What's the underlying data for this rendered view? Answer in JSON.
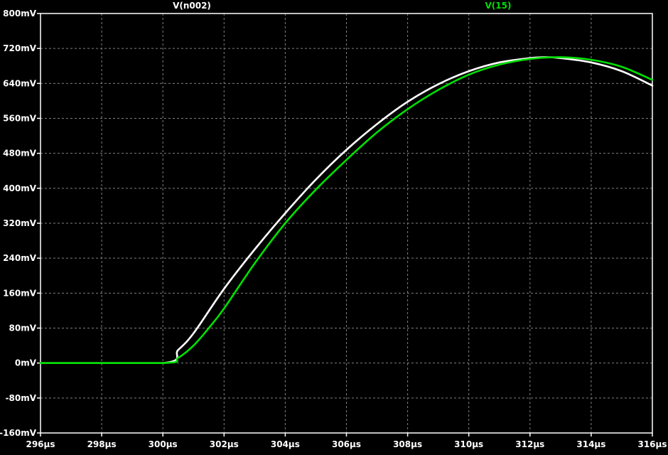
{
  "chart_data": {
    "type": "line",
    "title": "",
    "xlabel": "",
    "ylabel": "",
    "background": "#000000",
    "grid": true,
    "grid_color": "#808080",
    "axis_color": "#ffffff",
    "label_color": "#ffffff",
    "xlim": [
      296,
      316
    ],
    "ylim": [
      -160,
      800
    ],
    "x_ticks": [
      296,
      298,
      300,
      302,
      304,
      306,
      308,
      310,
      312,
      314,
      316
    ],
    "x_tick_labels": [
      "296µs",
      "298µs",
      "300µs",
      "302µs",
      "304µs",
      "306µs",
      "308µs",
      "310µs",
      "312µs",
      "314µs",
      "316µs"
    ],
    "y_ticks": [
      800,
      720,
      640,
      560,
      480,
      400,
      320,
      240,
      160,
      80,
      0,
      -80,
      -160
    ],
    "y_tick_labels": [
      "800mV",
      "720mV",
      "640mV",
      "560mV",
      "480mV",
      "400mV",
      "320mV",
      "240mV",
      "160mV",
      "80mV",
      "0mV",
      "-80mV",
      "-160mV"
    ],
    "series": [
      {
        "name": "V(n002)",
        "color": "#ffffff",
        "x": [
          296,
          300,
          300.5,
          301,
          302,
          303,
          304,
          305,
          306,
          307,
          308,
          309,
          310,
          311,
          312,
          312.5,
          313,
          314,
          315,
          316
        ],
        "y": [
          0,
          0,
          30,
          68,
          170,
          260,
          343,
          420,
          488,
          547,
          598,
          638,
          668,
          688,
          698,
          700,
          698,
          688,
          668,
          635
        ]
      },
      {
        "name": "V(15)",
        "color": "#00e000",
        "x": [
          296,
          300,
          300.5,
          301,
          301.5,
          302,
          303,
          304,
          305,
          306,
          307,
          308,
          309,
          310,
          311,
          312,
          313,
          314,
          315,
          316
        ],
        "y": [
          0,
          0,
          12,
          40,
          80,
          125,
          228,
          320,
          397,
          465,
          528,
          581,
          625,
          660,
          683,
          696,
          700,
          694,
          678,
          648
        ]
      }
    ]
  }
}
